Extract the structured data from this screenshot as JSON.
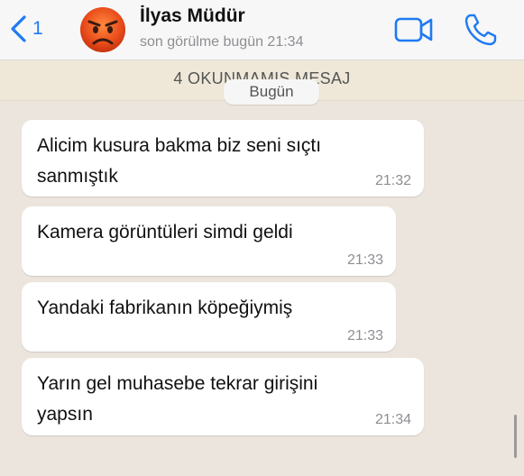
{
  "header": {
    "back_count": "1",
    "contact_name": "İlyas Müdür",
    "status": "son görülme bugün 21:34",
    "avatar_icon": "angry-face-emoji-icon",
    "accent_color": "#1f7af3"
  },
  "chat": {
    "unread_banner": "4 OKUNMAMIŞ MESAJ",
    "date_separator": "Bugün",
    "messages": [
      {
        "text": "Alicim kusura bakma biz seni sıçtı\nsanmıştık",
        "time": "21:32"
      },
      {
        "text": "Kamera görüntüleri simdi geldi",
        "time": "21:33"
      },
      {
        "text": "Yandaki fabrikanın köpeğiymiş",
        "time": "21:33"
      },
      {
        "text": "Yarın gel muhasebe tekrar girişini\nyapsın",
        "time": "21:34"
      }
    ]
  }
}
